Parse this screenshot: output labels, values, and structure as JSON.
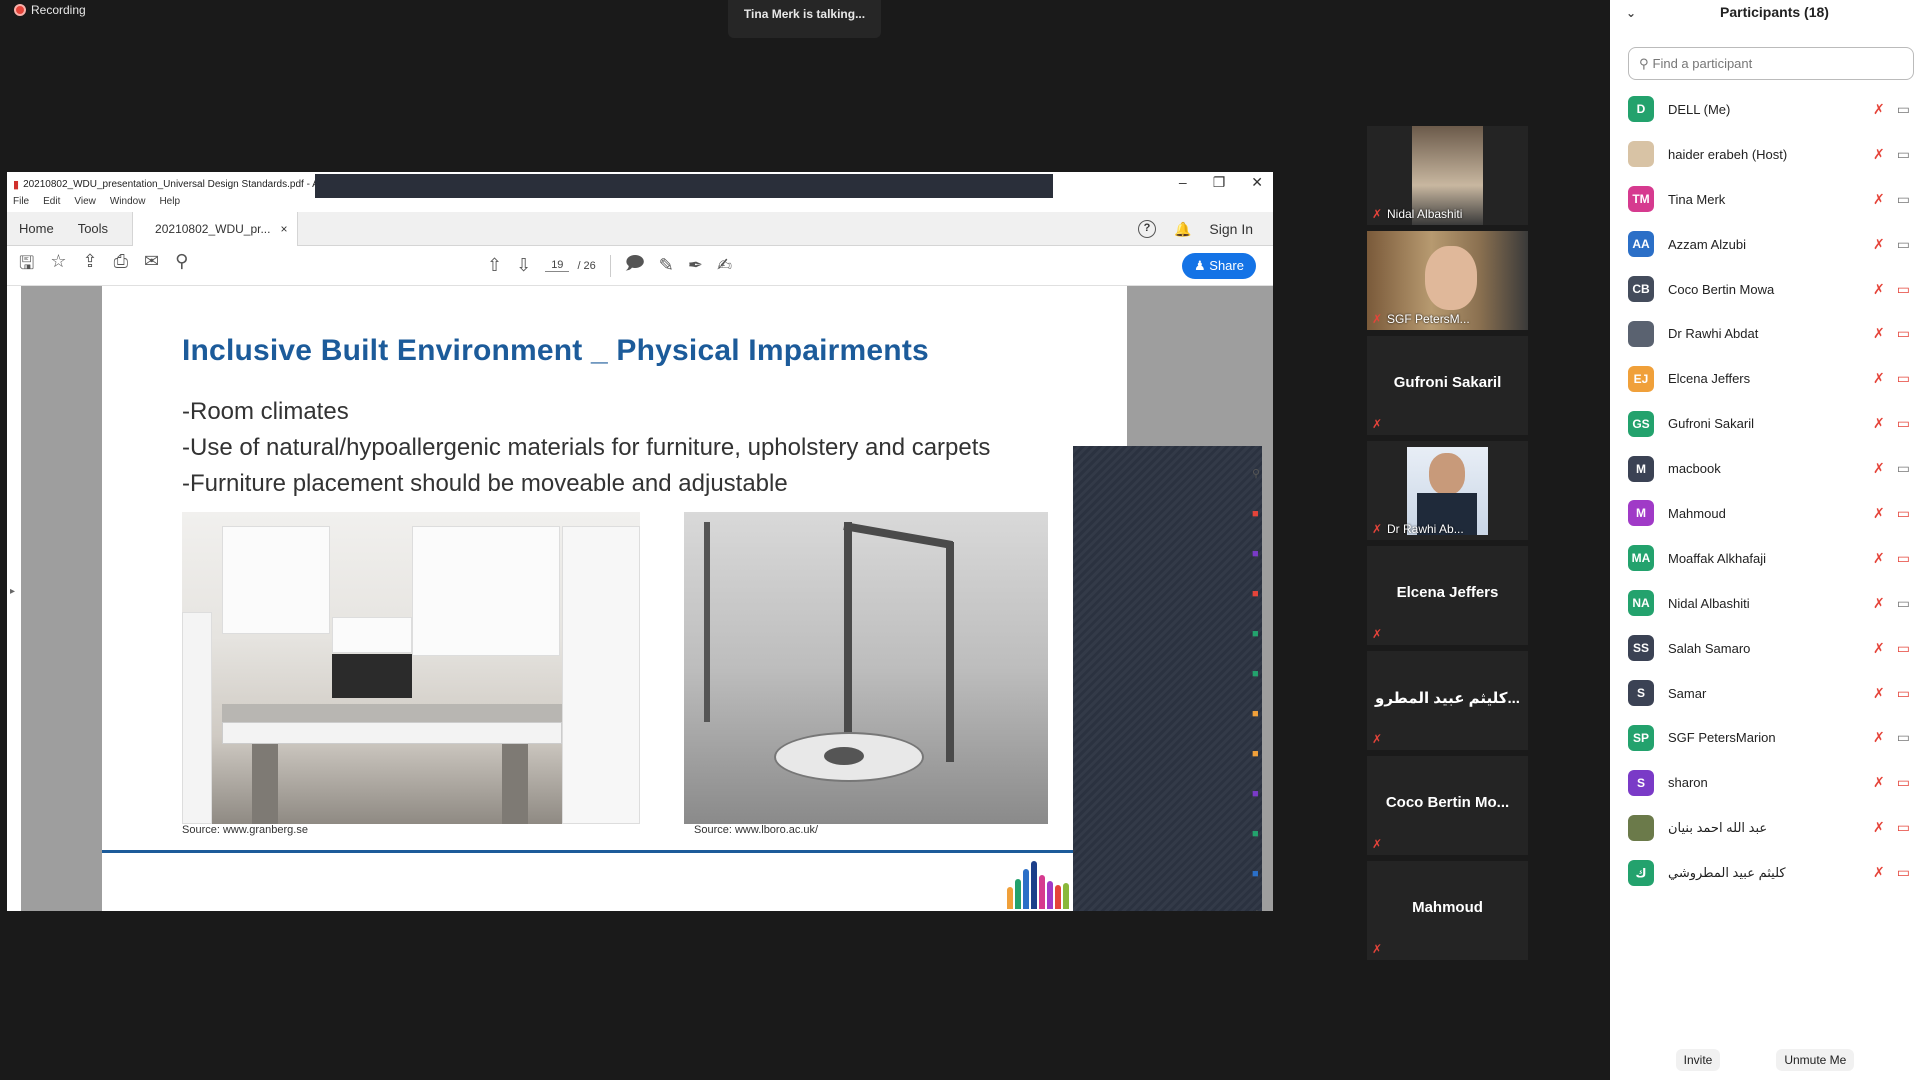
{
  "top": {
    "recording": "Recording",
    "talking": "Tina Merk is talking..."
  },
  "pdf": {
    "window_title": "20210802_WDU_presentation_Universal Design Standards.pdf - Ad",
    "menu": [
      "File",
      "Edit",
      "View",
      "Window",
      "Help"
    ],
    "nav": {
      "home": "Home",
      "tools": "Tools"
    },
    "tab_label": "20210802_WDU_pr...",
    "sign_in": "Sign In",
    "page_current": "19",
    "page_total": "/ 26",
    "share": "Share",
    "slide": {
      "title": "Inclusive Built Environment _ Physical Impairments",
      "bullets": [
        "-Room climates",
        "-Use of natural/hypoallergenic materials for furniture, upholstery and carpets",
        "-Furniture placement should be moveable and adjustable"
      ],
      "source_left": "Source: www.granberg.se",
      "source_right": "Source: www.lboro.ac.uk/"
    }
  },
  "gallery": [
    {
      "name": "Nidal Albashiti",
      "type": "video"
    },
    {
      "name": "SGF PetersM...",
      "type": "video"
    },
    {
      "name": "Gufroni Sakaril",
      "type": "name"
    },
    {
      "name": "Dr Rawhi Ab...",
      "type": "photo"
    },
    {
      "name": "Elcena Jeffers",
      "type": "name"
    },
    {
      "name": "كليثم عبيد المطرو...",
      "type": "name"
    },
    {
      "name": "Coco Bertin Mo...",
      "type": "name"
    },
    {
      "name": "Mahmoud",
      "type": "name"
    }
  ],
  "participants": {
    "title": "Participants (18)",
    "search_placeholder": "Find a participant",
    "list": [
      {
        "initials": "D",
        "name": "DELL (Me)",
        "color": "#23a26d",
        "cam": "on"
      },
      {
        "initials": "",
        "name": "haider erabeh (Host)",
        "color": "#d8c3a5",
        "cam": "on"
      },
      {
        "initials": "TM",
        "name": "Tina Merk",
        "color": "#d63a8f",
        "cam": "on"
      },
      {
        "initials": "AA",
        "name": "Azzam Alzubi",
        "color": "#2b6fc7",
        "cam": "on"
      },
      {
        "initials": "CB",
        "name": "Coco Bertin Mowa",
        "color": "#444c5c",
        "cam": "off"
      },
      {
        "initials": "",
        "name": "Dr Rawhi Abdat",
        "color": "#5a6270",
        "cam": "off"
      },
      {
        "initials": "EJ",
        "name": "Elcena Jeffers",
        "color": "#f0a03a",
        "cam": "off"
      },
      {
        "initials": "GS",
        "name": "Gufroni Sakaril",
        "color": "#23a26d",
        "cam": "off"
      },
      {
        "initials": "M",
        "name": "macbook",
        "color": "#3b4254",
        "cam": "on"
      },
      {
        "initials": "M",
        "name": "Mahmoud",
        "color": "#a03ac7",
        "cam": "off"
      },
      {
        "initials": "MA",
        "name": "Moaffak Alkhafaji",
        "color": "#23a26d",
        "cam": "off"
      },
      {
        "initials": "NA",
        "name": "Nidal Albashiti",
        "color": "#23a26d",
        "cam": "on"
      },
      {
        "initials": "SS",
        "name": "Salah Samaro",
        "color": "#3b4254",
        "cam": "off"
      },
      {
        "initials": "S",
        "name": "Samar",
        "color": "#3b4254",
        "cam": "off"
      },
      {
        "initials": "SP",
        "name": "SGF PetersMarion",
        "color": "#23a26d",
        "cam": "on"
      },
      {
        "initials": "S",
        "name": "sharon",
        "color": "#7a3ac7",
        "cam": "off"
      },
      {
        "initials": "",
        "name": "عبد الله احمد بنيان",
        "color": "#6b7a4a",
        "cam": "off"
      },
      {
        "initials": "ك",
        "name": "كليثم عبيد المطروشي",
        "color": "#23a26d",
        "cam": "off"
      }
    ],
    "invite": "Invite",
    "unmute": "Unmute Me"
  },
  "colors": {
    "accent": "#1c5b9a",
    "share_blue": "#1473e6",
    "mute_red": "#e5443a"
  }
}
